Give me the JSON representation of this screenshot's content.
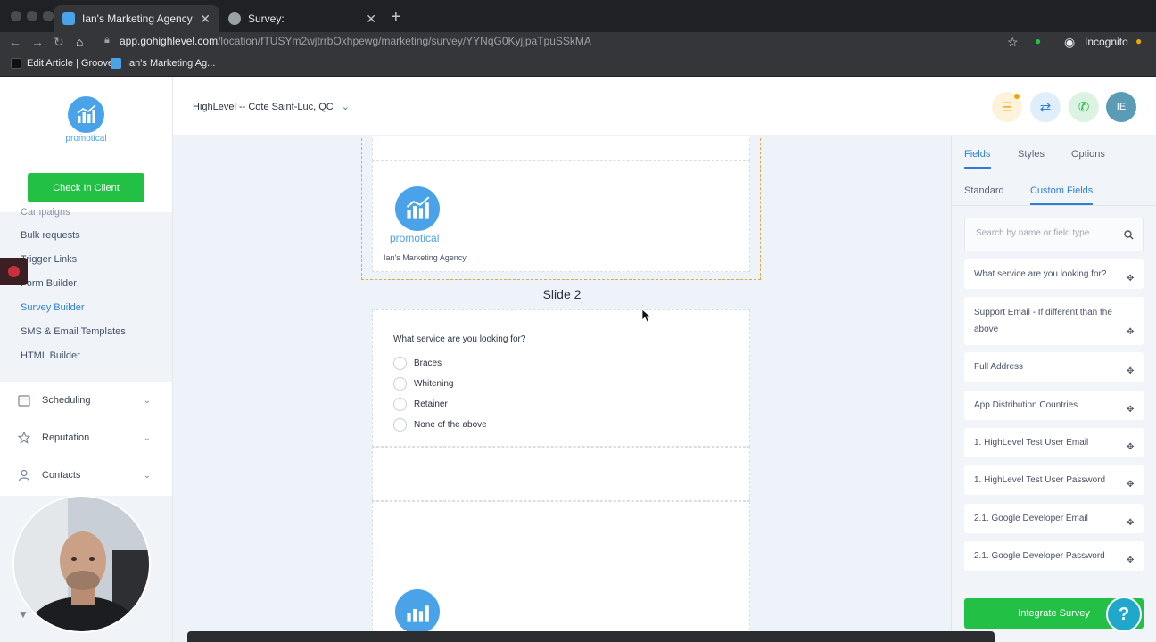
{
  "browser": {
    "tabs": [
      {
        "title": "Ian's Marketing Agency",
        "active": true
      },
      {
        "title": "Survey:",
        "active": false
      }
    ],
    "url_domain": "app.gohighlevel.com",
    "url_path": "/location/fTUSYm2wjtrrbOxhpewg/marketing/survey/YYNqG0KyjjpaTpuSSkMA",
    "profile": "Incognito",
    "bookmarks": [
      "Edit Article | Groove",
      "Ian's Marketing Ag..."
    ]
  },
  "brand": {
    "name": "promotical",
    "color": "#4aa3e8"
  },
  "sidebar": {
    "check_in_label": "Check In Client",
    "partial_item": "Campaigns",
    "marketing_items": [
      {
        "label": "Bulk requests",
        "active": false
      },
      {
        "label": "Trigger Links",
        "active": false
      },
      {
        "label": "Form Builder",
        "active": false
      },
      {
        "label": "Survey Builder",
        "active": true
      },
      {
        "label": "SMS & Email Templates",
        "active": false
      },
      {
        "label": "HTML Builder",
        "active": false
      }
    ],
    "groups": [
      {
        "label": "Scheduling",
        "icon": "calendar-icon"
      },
      {
        "label": "Reputation",
        "icon": "star-icon"
      },
      {
        "label": "Contacts",
        "icon": "user-icon"
      }
    ]
  },
  "header": {
    "location": "HighLevel -- Cote Saint-Luc, QC",
    "avatar_initials": "IE"
  },
  "survey": {
    "header_caption": "Ian's Marketing Agency",
    "slide_title": "Slide 2",
    "question": "What service are you looking for?",
    "options": [
      "Braces",
      "Whitening",
      "Retainer",
      "None of the above"
    ]
  },
  "panel": {
    "tabs": [
      "Fields",
      "Styles",
      "Options"
    ],
    "subtabs": [
      "Standard",
      "Custom Fields"
    ],
    "search_placeholder": "Search by name or field type",
    "fields": [
      "What service are you looking for?",
      "Support Email - If different than the above",
      "Full Address",
      "App Distribution Countries",
      "1. HighLevel Test User Email",
      "1. HighLevel Test User Password",
      "2.1. Google Developer Email",
      "2.1. Google Developer Password"
    ],
    "integrate_label": "Integrate Survey",
    "help_label": "?"
  },
  "colors": {
    "accent": "#2f80d1",
    "green": "#22c045",
    "orange": "#f0a500"
  }
}
